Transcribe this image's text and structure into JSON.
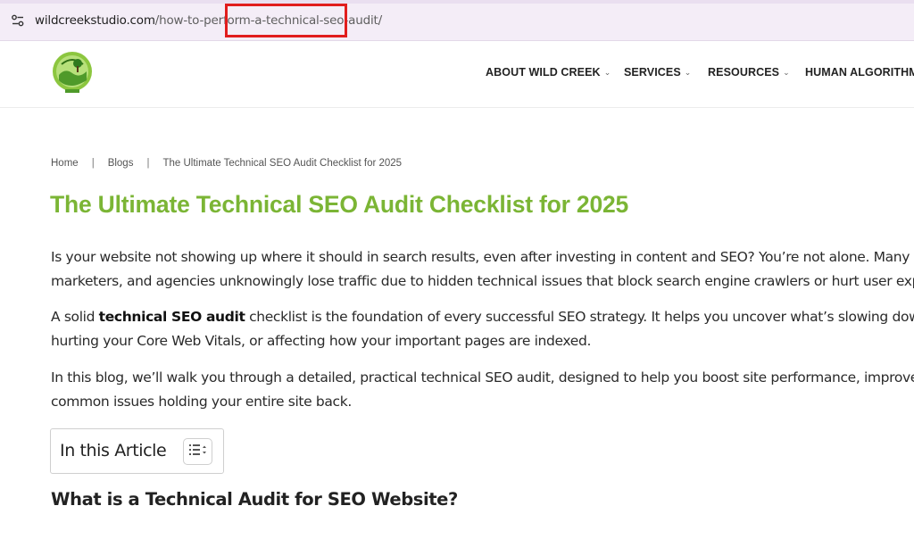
{
  "browser": {
    "url_host": "wildcreekstudio.com",
    "url_path": "/how-to-perform-a-technical-seo-audit/",
    "site_info_icon": "tune-icon",
    "highlight_color": "#e11d1d"
  },
  "header": {
    "logo_icon": "wild-creek-studio-logo",
    "nav": [
      {
        "label": "ABOUT WILD CREEK",
        "chevron": "⌄"
      },
      {
        "label": "SERVICES",
        "chevron": "⌄"
      },
      {
        "label": "RESOURCES",
        "chevron": "⌄"
      },
      {
        "label": "HUMAN ALGORITHM",
        "chevron": ""
      }
    ]
  },
  "breadcrumb": {
    "home": "Home",
    "separator": "|",
    "blogs": "Blogs",
    "current": "The Ultimate Technical SEO Audit Checklist for 2025"
  },
  "article": {
    "title": "The Ultimate Technical SEO Audit Checklist for 2025",
    "title_color": "#7bb535",
    "p1_line1": "Is your website not showing up where it should in search results, even after investing in content and SEO? You’re not alone. Many busi",
    "p1_line2": "marketers, and agencies unknowingly lose traffic due to hidden technical issues that block search engine crawlers or hurt user experi",
    "p2_line1_before": "A solid ",
    "p2_line1_bold": "technical SEO audit",
    "p2_line1_after": " checklist is the foundation of every successful SEO strategy. It helps you uncover what’s slowing down you",
    "p2_line2": "hurting your Core Web Vitals, or affecting how your important pages are indexed.",
    "p3_line1": "In this blog, we’ll walk you through a detailed, practical technical SEO audit, designed to help you boost site performance, improve ra",
    "p3_line2": "common issues holding your entire site back.",
    "toc_label": "In this Article",
    "toc_toggle_icon": "list-toggle-icon",
    "section_heading": "What is a Technical Audit for SEO Website?"
  }
}
